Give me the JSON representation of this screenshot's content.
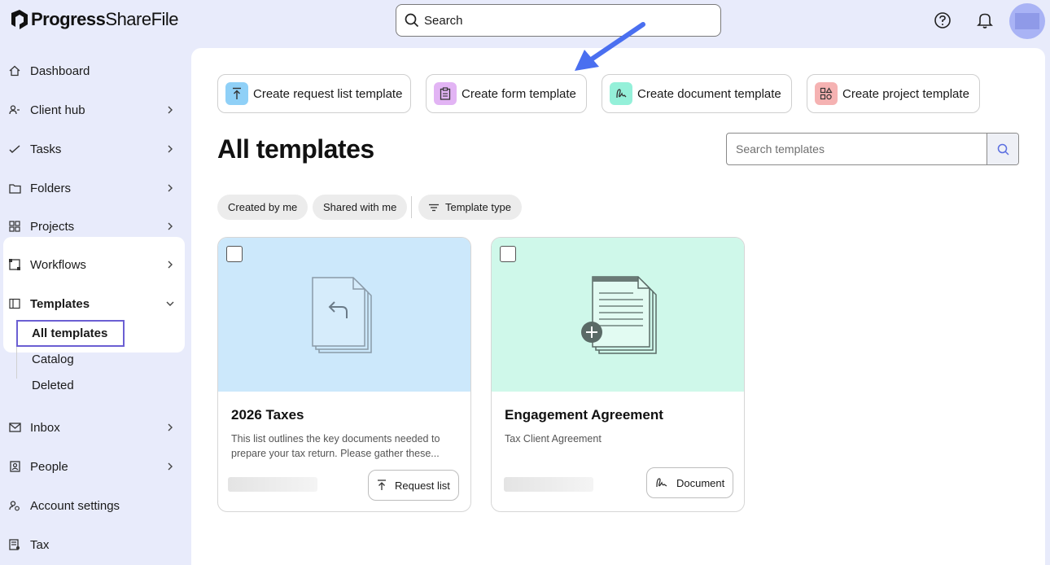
{
  "brand": {
    "name_bold": "Progress",
    "name_light": "ShareFile"
  },
  "header": {
    "search_placeholder": "Search",
    "help_icon": "help-circle-icon",
    "bell_icon": "bell-icon"
  },
  "sidebar": {
    "items": [
      {
        "label": "Dashboard",
        "icon": "home-icon"
      },
      {
        "label": "Client hub",
        "icon": "users-icon"
      },
      {
        "label": "Tasks",
        "icon": "check-icon"
      },
      {
        "label": "Folders",
        "icon": "folder-icon"
      },
      {
        "label": "Projects",
        "icon": "grid-icon"
      },
      {
        "label": "Workflows",
        "icon": "workflow-icon"
      },
      {
        "label": "Templates",
        "icon": "template-icon"
      },
      {
        "label": "Inbox",
        "icon": "mail-icon"
      },
      {
        "label": "People",
        "icon": "contact-icon"
      },
      {
        "label": "Account settings",
        "icon": "account-settings-icon"
      },
      {
        "label": "Tax",
        "icon": "tax-icon"
      }
    ],
    "templates_sub": [
      "All templates",
      "Catalog",
      "Deleted"
    ],
    "active_sub": "All templates"
  },
  "create_buttons": [
    {
      "label": "Create request list template",
      "color": "#8fd0f7"
    },
    {
      "label": "Create form template",
      "color": "#e2b4f4"
    },
    {
      "label": "Create document template",
      "color": "#94f0d9"
    },
    {
      "label": "Create project template",
      "color": "#f5b2b2"
    }
  ],
  "page_title": "All templates",
  "template_search": {
    "placeholder": "Search templates"
  },
  "filters": [
    "Created by me",
    "Shared with me",
    "Template type"
  ],
  "cards": [
    {
      "title": "2026 Taxes",
      "description": "This list outlines the key documents needed to prepare your tax return. Please gather these...",
      "tag": "Request list",
      "hero_color": "#cce8fb"
    },
    {
      "title": "Engagement Agreement",
      "description": "Tax Client Agreement",
      "tag": "Document",
      "hero_color": "#cff8ea"
    }
  ],
  "colors": {
    "background": "#e8ebfb",
    "accent": "#6b5fd3",
    "arrow": "#4a6ff0"
  }
}
